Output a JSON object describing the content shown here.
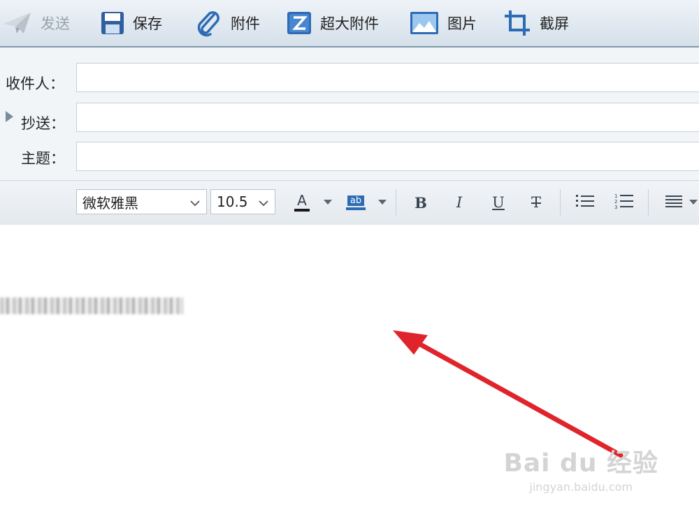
{
  "toolbar": {
    "send_label": "发送",
    "save_label": "保存",
    "attach_label": "附件",
    "large_attach_label": "超大附件",
    "image_label": "图片",
    "screenshot_label": "截屏"
  },
  "fields": {
    "to_label": "收件人：",
    "cc_label": "抄送：",
    "subject_label": "主题："
  },
  "format": {
    "font_family": "微软雅黑",
    "font_size": "10.5",
    "font_color_icon": "A",
    "highlight_icon": "ab",
    "bold": "B",
    "italic": "I",
    "underline": "U",
    "strike": "T"
  },
  "watermark": {
    "brand": "Bai du 经验",
    "url": "jingyan.baidu.com"
  },
  "colors": {
    "annotation_arrow": "#e0242b",
    "toolbar_icon": "#2e6bb5"
  }
}
